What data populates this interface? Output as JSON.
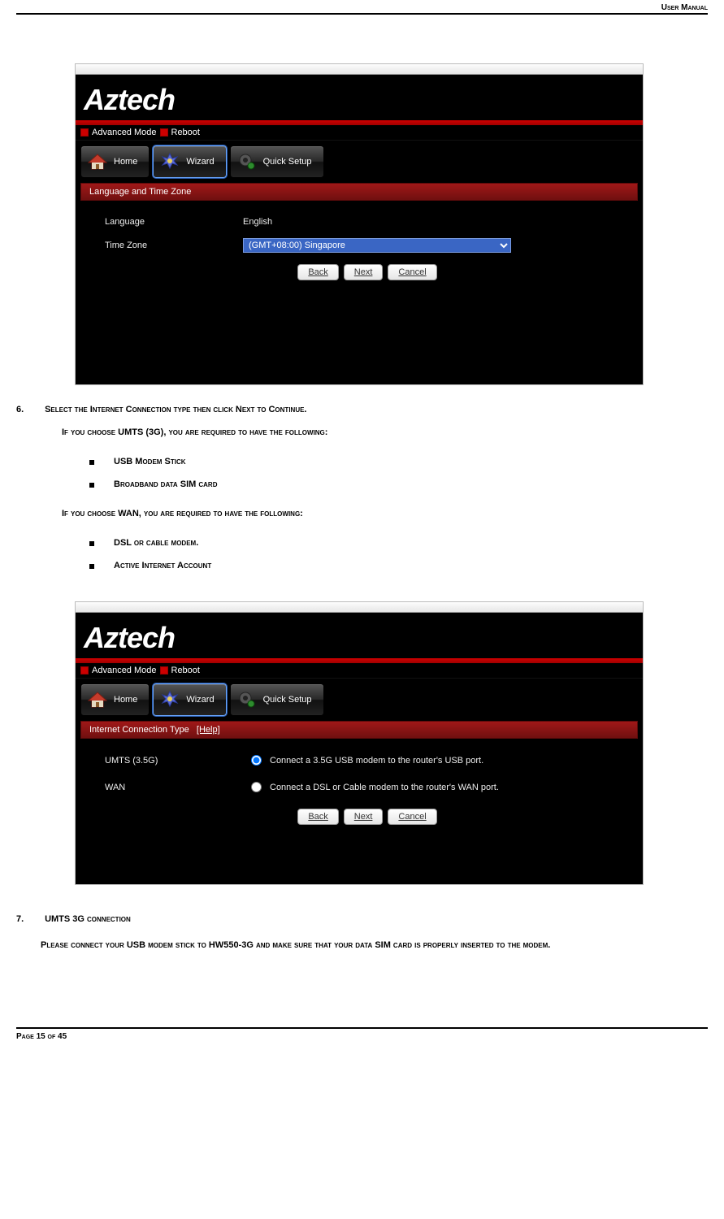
{
  "header": {
    "label": "User Manual"
  },
  "footer": {
    "label": "Page 15 of 45"
  },
  "brand": "Aztech",
  "menubar": {
    "advanced": "Advanced Mode",
    "reboot": "Reboot"
  },
  "tabs": {
    "home": "Home",
    "wizard": "Wizard",
    "quick": "Quick Setup"
  },
  "screenshot1": {
    "section": "Language and Time Zone",
    "lang_label": "Language",
    "lang_value": "English",
    "tz_label": "Time Zone",
    "tz_value": "(GMT+08:00) Singapore"
  },
  "buttons": {
    "back": "Back",
    "next": "Next",
    "cancel": "Cancel"
  },
  "step6": {
    "num": "6.",
    "title": "Select the Internet Connection type then click Next to Continue.",
    "umts_line": "If you choose UMTS (3G), you are required to have the following:",
    "umts_items": [
      "USB Modem Stick",
      "Broadband data SIM card"
    ],
    "wan_line": "If you choose WAN, you are required to have the following:",
    "wan_items": [
      "DSL or cable modem.",
      "Active Internet Account"
    ]
  },
  "screenshot2": {
    "section": "Internet Connection Type",
    "help": "[Help]",
    "umts_label": "UMTS (3.5G)",
    "umts_desc": "Connect a 3.5G USB modem to the router's USB port.",
    "wan_label": "WAN",
    "wan_desc": "Connect a DSL or Cable modem to the router's WAN port."
  },
  "step7": {
    "num": "7.",
    "title": "UMTS 3G connection",
    "body": "Please connect your USB modem stick to HW550-3G and make sure that your data SIM card is properly inserted to the modem."
  }
}
